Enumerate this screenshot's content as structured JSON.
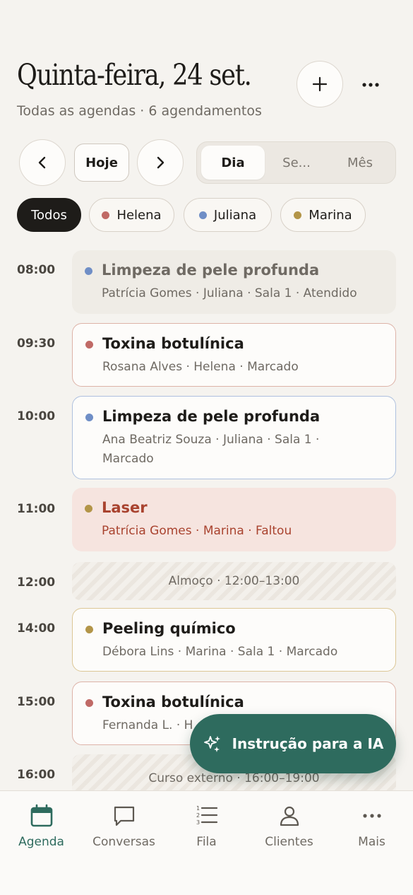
{
  "header": {
    "title": "Quinta-feira, 24 set.",
    "subtitle": "Todas as agendas · 6 agendamentos",
    "add_icon": "plus-icon",
    "more_icon": "more-horizontal-icon"
  },
  "toolbar": {
    "prev_icon": "chevron-left-icon",
    "today_label": "Hoje",
    "next_icon": "chevron-right-icon",
    "views": [
      "Dia",
      "Se...",
      "Mês"
    ],
    "active_view": "Dia"
  },
  "filters": [
    {
      "label": "Todos",
      "active": true
    },
    {
      "label": "Helena",
      "color": "#c06a66"
    },
    {
      "label": "Juliana",
      "color": "#6f8ec6"
    },
    {
      "label": "Marina",
      "color": "#b39548"
    }
  ],
  "schedule": [
    {
      "time": "08:00",
      "title": "Limpeza de pele profunda",
      "meta": "Patrícia Gomes · Juliana · Sala 1 · Atendido"
    },
    {
      "time": "09:30",
      "title": "Toxina botulínica",
      "meta": "Rosana Alves · Helena · Marcado"
    },
    {
      "time": "10:00",
      "title": "Limpeza de pele profunda",
      "meta": "Ana Beatriz Souza · Juliana · Sala 1 · Marcado"
    },
    {
      "time": "11:00",
      "title": "Laser",
      "meta": "Patrícia Gomes · Marina · Faltou"
    },
    {
      "time": "12:00",
      "block": "Almoço · 12:00–13:00"
    },
    {
      "time": "14:00",
      "title": "Peeling químico",
      "meta": "Débora Lins · Marina · Sala 1 · Marcado"
    },
    {
      "time": "15:00",
      "title": "Toxina botulínica",
      "meta": "Fernanda L. · H"
    },
    {
      "time": "16:00",
      "block": "Curso externo · 16:00–19:00"
    }
  ],
  "fab": {
    "label": "Instrução para a IA",
    "icon": "sparkles-icon"
  },
  "nav": [
    {
      "label": "Agenda",
      "icon": "calendar-icon",
      "active": true
    },
    {
      "label": "Conversas",
      "icon": "chat-icon"
    },
    {
      "label": "Fila",
      "icon": "numbered-list-icon"
    },
    {
      "label": "Clientes",
      "icon": "user-icon"
    },
    {
      "label": "Mais",
      "icon": "more-horizontal-icon"
    }
  ],
  "colors": {
    "accent": "#2e6b5e",
    "helena": "#c06a66",
    "juliana": "#6f8ec6",
    "marina": "#b39548",
    "missed": "#a9432f"
  }
}
